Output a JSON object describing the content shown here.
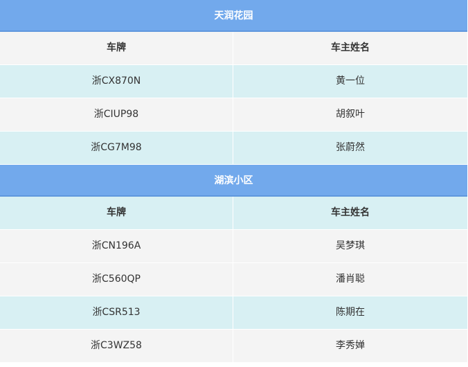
{
  "groups": [
    {
      "title": "天润花园",
      "headers": {
        "plate": "车牌",
        "owner": "车主姓名"
      },
      "rows": [
        {
          "plate": "浙CX870N",
          "owner": "黄一位"
        },
        {
          "plate": "浙CIUP98",
          "owner": "胡叙叶"
        },
        {
          "plate": "浙CG7M98",
          "owner": "张蔚然"
        }
      ]
    },
    {
      "title": "湖滨小区",
      "headers": {
        "plate": "车牌",
        "owner": "车主姓名"
      },
      "rows": [
        {
          "plate": "浙CN196A",
          "owner": "吴梦琪"
        },
        {
          "plate": "浙C560QP",
          "owner": "潘肖聪"
        },
        {
          "plate": "浙CSR513",
          "owner": "陈期在"
        },
        {
          "plate": "浙C3WZ58",
          "owner": "李秀婵"
        }
      ]
    }
  ],
  "colors": {
    "group_header_bg": "#72a9ec",
    "row_gray": "#f4f4f4",
    "row_blue": "#d8f0f3"
  }
}
